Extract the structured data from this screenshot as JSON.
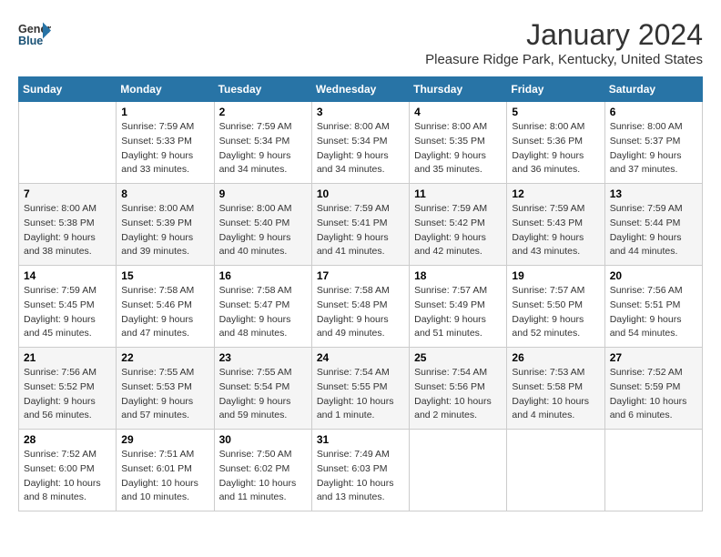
{
  "header": {
    "logo_line1": "General",
    "logo_line2": "Blue",
    "month_year": "January 2024",
    "location": "Pleasure Ridge Park, Kentucky, United States"
  },
  "weekdays": [
    "Sunday",
    "Monday",
    "Tuesday",
    "Wednesday",
    "Thursday",
    "Friday",
    "Saturday"
  ],
  "weeks": [
    [
      {
        "day": "",
        "sunrise": "",
        "sunset": "",
        "daylight": ""
      },
      {
        "day": "1",
        "sunrise": "Sunrise: 7:59 AM",
        "sunset": "Sunset: 5:33 PM",
        "daylight": "Daylight: 9 hours and 33 minutes."
      },
      {
        "day": "2",
        "sunrise": "Sunrise: 7:59 AM",
        "sunset": "Sunset: 5:34 PM",
        "daylight": "Daylight: 9 hours and 34 minutes."
      },
      {
        "day": "3",
        "sunrise": "Sunrise: 8:00 AM",
        "sunset": "Sunset: 5:34 PM",
        "daylight": "Daylight: 9 hours and 34 minutes."
      },
      {
        "day": "4",
        "sunrise": "Sunrise: 8:00 AM",
        "sunset": "Sunset: 5:35 PM",
        "daylight": "Daylight: 9 hours and 35 minutes."
      },
      {
        "day": "5",
        "sunrise": "Sunrise: 8:00 AM",
        "sunset": "Sunset: 5:36 PM",
        "daylight": "Daylight: 9 hours and 36 minutes."
      },
      {
        "day": "6",
        "sunrise": "Sunrise: 8:00 AM",
        "sunset": "Sunset: 5:37 PM",
        "daylight": "Daylight: 9 hours and 37 minutes."
      }
    ],
    [
      {
        "day": "7",
        "sunrise": "Sunrise: 8:00 AM",
        "sunset": "Sunset: 5:38 PM",
        "daylight": "Daylight: 9 hours and 38 minutes."
      },
      {
        "day": "8",
        "sunrise": "Sunrise: 8:00 AM",
        "sunset": "Sunset: 5:39 PM",
        "daylight": "Daylight: 9 hours and 39 minutes."
      },
      {
        "day": "9",
        "sunrise": "Sunrise: 8:00 AM",
        "sunset": "Sunset: 5:40 PM",
        "daylight": "Daylight: 9 hours and 40 minutes."
      },
      {
        "day": "10",
        "sunrise": "Sunrise: 7:59 AM",
        "sunset": "Sunset: 5:41 PM",
        "daylight": "Daylight: 9 hours and 41 minutes."
      },
      {
        "day": "11",
        "sunrise": "Sunrise: 7:59 AM",
        "sunset": "Sunset: 5:42 PM",
        "daylight": "Daylight: 9 hours and 42 minutes."
      },
      {
        "day": "12",
        "sunrise": "Sunrise: 7:59 AM",
        "sunset": "Sunset: 5:43 PM",
        "daylight": "Daylight: 9 hours and 43 minutes."
      },
      {
        "day": "13",
        "sunrise": "Sunrise: 7:59 AM",
        "sunset": "Sunset: 5:44 PM",
        "daylight": "Daylight: 9 hours and 44 minutes."
      }
    ],
    [
      {
        "day": "14",
        "sunrise": "Sunrise: 7:59 AM",
        "sunset": "Sunset: 5:45 PM",
        "daylight": "Daylight: 9 hours and 45 minutes."
      },
      {
        "day": "15",
        "sunrise": "Sunrise: 7:58 AM",
        "sunset": "Sunset: 5:46 PM",
        "daylight": "Daylight: 9 hours and 47 minutes."
      },
      {
        "day": "16",
        "sunrise": "Sunrise: 7:58 AM",
        "sunset": "Sunset: 5:47 PM",
        "daylight": "Daylight: 9 hours and 48 minutes."
      },
      {
        "day": "17",
        "sunrise": "Sunrise: 7:58 AM",
        "sunset": "Sunset: 5:48 PM",
        "daylight": "Daylight: 9 hours and 49 minutes."
      },
      {
        "day": "18",
        "sunrise": "Sunrise: 7:57 AM",
        "sunset": "Sunset: 5:49 PM",
        "daylight": "Daylight: 9 hours and 51 minutes."
      },
      {
        "day": "19",
        "sunrise": "Sunrise: 7:57 AM",
        "sunset": "Sunset: 5:50 PM",
        "daylight": "Daylight: 9 hours and 52 minutes."
      },
      {
        "day": "20",
        "sunrise": "Sunrise: 7:56 AM",
        "sunset": "Sunset: 5:51 PM",
        "daylight": "Daylight: 9 hours and 54 minutes."
      }
    ],
    [
      {
        "day": "21",
        "sunrise": "Sunrise: 7:56 AM",
        "sunset": "Sunset: 5:52 PM",
        "daylight": "Daylight: 9 hours and 56 minutes."
      },
      {
        "day": "22",
        "sunrise": "Sunrise: 7:55 AM",
        "sunset": "Sunset: 5:53 PM",
        "daylight": "Daylight: 9 hours and 57 minutes."
      },
      {
        "day": "23",
        "sunrise": "Sunrise: 7:55 AM",
        "sunset": "Sunset: 5:54 PM",
        "daylight": "Daylight: 9 hours and 59 minutes."
      },
      {
        "day": "24",
        "sunrise": "Sunrise: 7:54 AM",
        "sunset": "Sunset: 5:55 PM",
        "daylight": "Daylight: 10 hours and 1 minute."
      },
      {
        "day": "25",
        "sunrise": "Sunrise: 7:54 AM",
        "sunset": "Sunset: 5:56 PM",
        "daylight": "Daylight: 10 hours and 2 minutes."
      },
      {
        "day": "26",
        "sunrise": "Sunrise: 7:53 AM",
        "sunset": "Sunset: 5:58 PM",
        "daylight": "Daylight: 10 hours and 4 minutes."
      },
      {
        "day": "27",
        "sunrise": "Sunrise: 7:52 AM",
        "sunset": "Sunset: 5:59 PM",
        "daylight": "Daylight: 10 hours and 6 minutes."
      }
    ],
    [
      {
        "day": "28",
        "sunrise": "Sunrise: 7:52 AM",
        "sunset": "Sunset: 6:00 PM",
        "daylight": "Daylight: 10 hours and 8 minutes."
      },
      {
        "day": "29",
        "sunrise": "Sunrise: 7:51 AM",
        "sunset": "Sunset: 6:01 PM",
        "daylight": "Daylight: 10 hours and 10 minutes."
      },
      {
        "day": "30",
        "sunrise": "Sunrise: 7:50 AM",
        "sunset": "Sunset: 6:02 PM",
        "daylight": "Daylight: 10 hours and 11 minutes."
      },
      {
        "day": "31",
        "sunrise": "Sunrise: 7:49 AM",
        "sunset": "Sunset: 6:03 PM",
        "daylight": "Daylight: 10 hours and 13 minutes."
      },
      {
        "day": "",
        "sunrise": "",
        "sunset": "",
        "daylight": ""
      },
      {
        "day": "",
        "sunrise": "",
        "sunset": "",
        "daylight": ""
      },
      {
        "day": "",
        "sunrise": "",
        "sunset": "",
        "daylight": ""
      }
    ]
  ]
}
